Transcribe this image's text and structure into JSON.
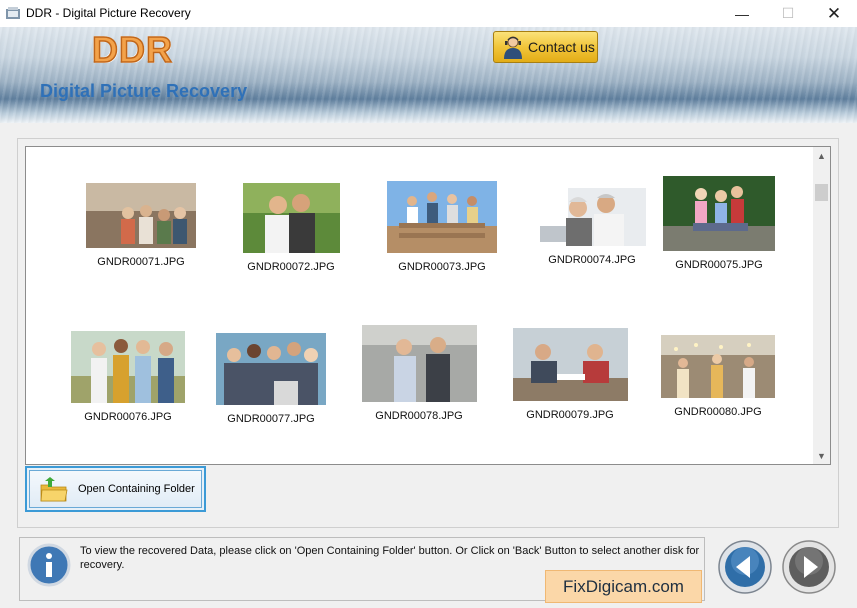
{
  "window": {
    "title": "DDR - Digital Picture Recovery",
    "minimize": "—",
    "maximize": "☐",
    "close": "✕"
  },
  "header": {
    "logo": "DDR",
    "subtitle": "Digital Picture Recovery",
    "contact_label": "Contact us"
  },
  "gallery": {
    "items": [
      {
        "name": "GNDR00071.JPG"
      },
      {
        "name": "GNDR00072.JPG"
      },
      {
        "name": "GNDR00073.JPG"
      },
      {
        "name": "GNDR00074.JPG"
      },
      {
        "name": "GNDR00075.JPG"
      },
      {
        "name": "GNDR00076.JPG"
      },
      {
        "name": "GNDR00077.JPG"
      },
      {
        "name": "GNDR00078.JPG"
      },
      {
        "name": "GNDR00079.JPG"
      },
      {
        "name": "GNDR00080.JPG"
      }
    ]
  },
  "actions": {
    "open_folder_label": "Open Containing Folder"
  },
  "status": {
    "message": "To view the recovered Data, please click on 'Open Containing Folder' button. Or Click on 'Back' Button to select another disk for recovery."
  },
  "watermark": "FixDigicam.com",
  "colors": {
    "accent": "#2f71b8",
    "logo": "#f3a24a",
    "contact_button": "#f1c53a",
    "watermark_bg": "#fbd7a8"
  }
}
